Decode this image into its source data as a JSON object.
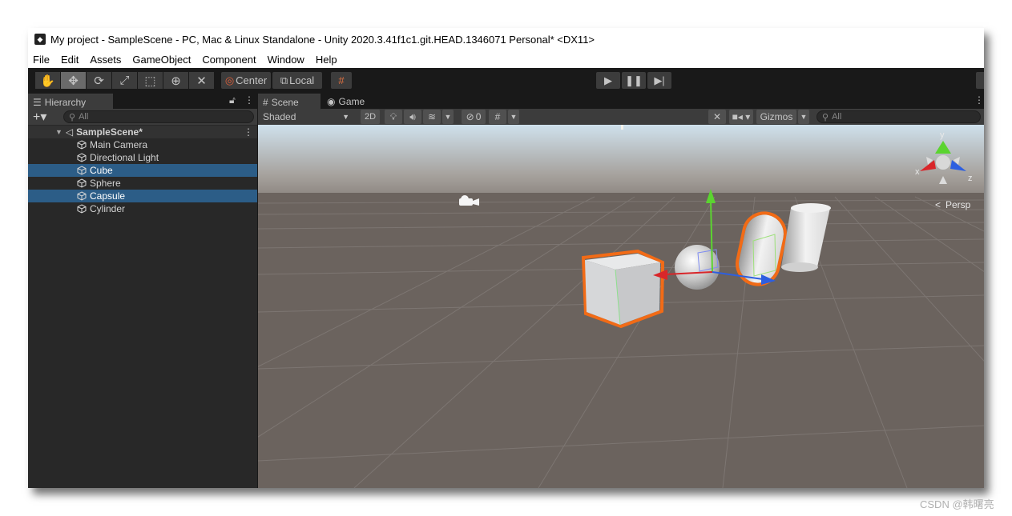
{
  "window": {
    "title": "My project - SampleScene - PC, Mac & Linux Standalone - Unity 2020.3.41f1c1.git.HEAD.1346071 Personal* <DX11>"
  },
  "menu": [
    "File",
    "Edit",
    "Assets",
    "GameObject",
    "Component",
    "Window",
    "Help"
  ],
  "toolbar": {
    "pivot_label": "Center",
    "space_label": "Local"
  },
  "hierarchy": {
    "tab_label": "Hierarchy",
    "search_placeholder": "All",
    "scene_name": "SampleScene*",
    "items": [
      {
        "label": "Main Camera",
        "selected": false
      },
      {
        "label": "Directional Light",
        "selected": false
      },
      {
        "label": "Cube",
        "selected": true
      },
      {
        "label": "Sphere",
        "selected": false
      },
      {
        "label": "Capsule",
        "selected": true
      },
      {
        "label": "Cylinder",
        "selected": false
      }
    ]
  },
  "scene_view": {
    "tabs": [
      "Scene",
      "Game"
    ],
    "shading_mode": "Shaded",
    "mode_2d": "2D",
    "hidden_count": "0",
    "gizmos_label": "Gizmos",
    "search_placeholder": "All",
    "projection_label": "Persp",
    "axis_labels": {
      "x": "x",
      "y": "y",
      "z": "z"
    }
  },
  "colors": {
    "selected_row": "#2c5d87",
    "selection_outline": "#f26b16",
    "axis_x": "#d9262a",
    "axis_y": "#5bd430",
    "axis_z": "#2d5fe0"
  },
  "watermark": "CSDN @韩曙亮"
}
